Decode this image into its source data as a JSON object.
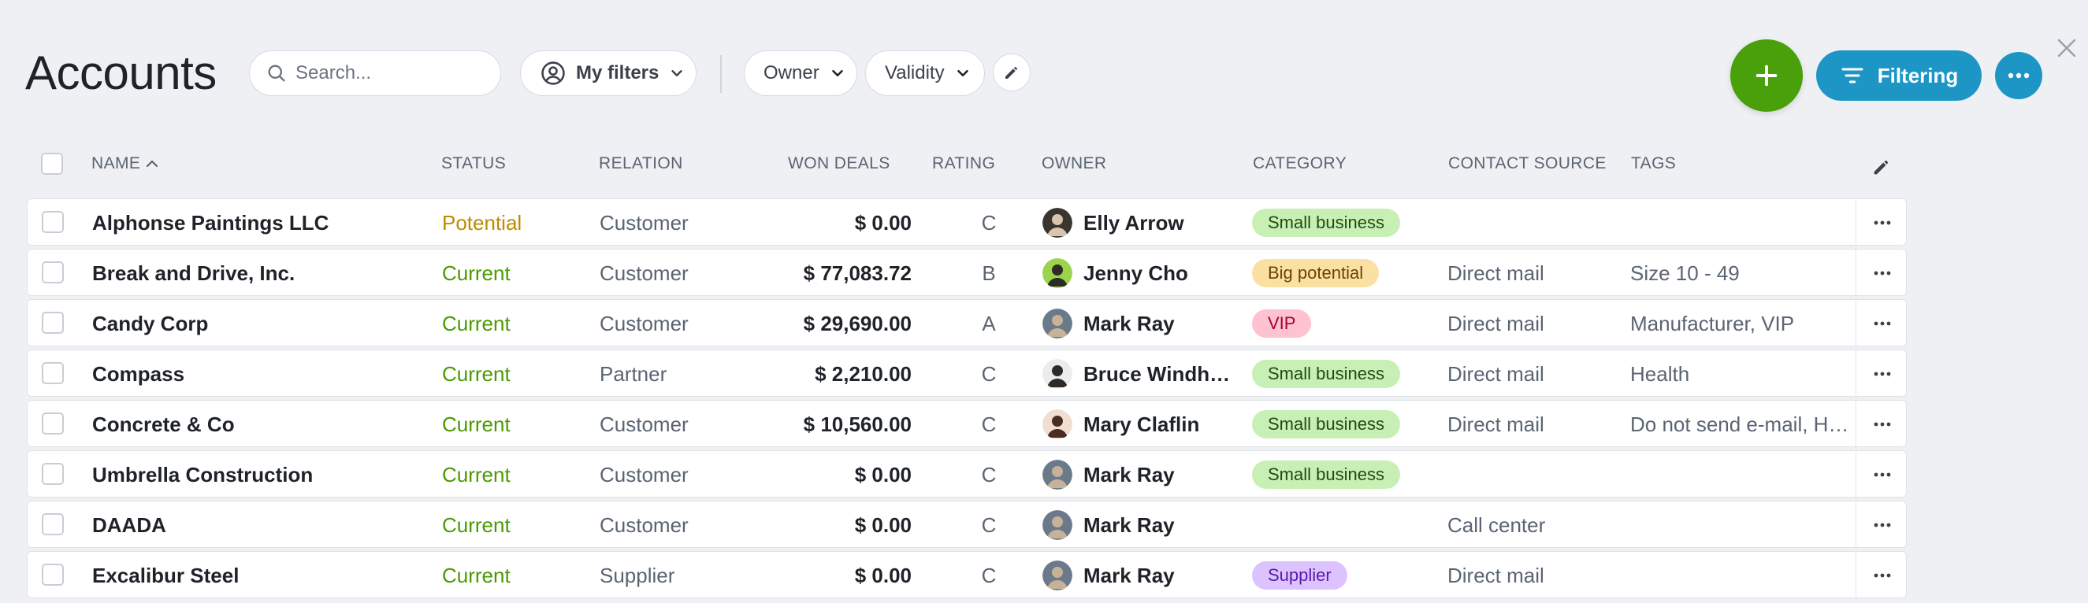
{
  "page": {
    "title": "Accounts"
  },
  "search": {
    "placeholder": "Search..."
  },
  "filters": {
    "my_filters_label": "My filters",
    "owner_label": "Owner",
    "validity_label": "Validity"
  },
  "actions": {
    "filtering_label": "Filtering"
  },
  "colors": {
    "accent_green": "#49a00b",
    "accent_blue": "#1d96c6",
    "status_potential": "#c08a00",
    "status_current": "#4a9a00"
  },
  "table": {
    "columns": {
      "name": "NAME",
      "status": "STATUS",
      "relation": "RELATION",
      "won_deals": "WON DEALS",
      "rating": "RATING",
      "owner": "OWNER",
      "category": "CATEGORY",
      "contact_source": "CONTACT SOURCE",
      "tags": "TAGS"
    },
    "sort_indicator": "^",
    "rows": [
      {
        "name": "Alphonse Paintings LLC",
        "status": "Potential",
        "relation": "Customer",
        "won_deals": "$ 0.00",
        "rating": "C",
        "owner": "Elly Arrow",
        "category": "Small business",
        "category_kind": "small",
        "contact_source": "",
        "tags": ""
      },
      {
        "name": "Break and Drive, Inc.",
        "status": "Current",
        "relation": "Customer",
        "won_deals": "$ 77,083.72",
        "rating": "B",
        "owner": "Jenny Cho",
        "category": "Big potential",
        "category_kind": "big",
        "contact_source": "Direct mail",
        "tags": "Size 10 - 49"
      },
      {
        "name": "Candy Corp",
        "status": "Current",
        "relation": "Customer",
        "won_deals": "$ 29,690.00",
        "rating": "A",
        "owner": "Mark Ray",
        "category": "VIP",
        "category_kind": "vip",
        "contact_source": "Direct mail",
        "tags": "Manufacturer, VIP"
      },
      {
        "name": "Compass",
        "status": "Current",
        "relation": "Partner",
        "won_deals": "$ 2,210.00",
        "rating": "C",
        "owner": "Bruce Windh…",
        "category": "Small business",
        "category_kind": "small",
        "contact_source": "Direct mail",
        "tags": "Health"
      },
      {
        "name": "Concrete & Co",
        "status": "Current",
        "relation": "Customer",
        "won_deals": "$ 10,560.00",
        "rating": "C",
        "owner": "Mary Claflin",
        "category": "Small business",
        "category_kind": "small",
        "contact_source": "Direct mail",
        "tags": "Do not send e-mail, H…"
      },
      {
        "name": "Umbrella Construction",
        "status": "Current",
        "relation": "Customer",
        "won_deals": "$ 0.00",
        "rating": "C",
        "owner": "Mark Ray",
        "category": "Small business",
        "category_kind": "small",
        "contact_source": "",
        "tags": ""
      },
      {
        "name": "DAADA",
        "status": "Current",
        "relation": "Customer",
        "won_deals": "$ 0.00",
        "rating": "C",
        "owner": "Mark Ray",
        "category": "",
        "category_kind": "",
        "contact_source": "Call center",
        "tags": ""
      },
      {
        "name": "Excalibur Steel",
        "status": "Current",
        "relation": "Supplier",
        "won_deals": "$ 0.00",
        "rating": "C",
        "owner": "Mark Ray",
        "category": "Supplier",
        "category_kind": "supplier",
        "contact_source": "Direct mail",
        "tags": ""
      }
    ]
  }
}
